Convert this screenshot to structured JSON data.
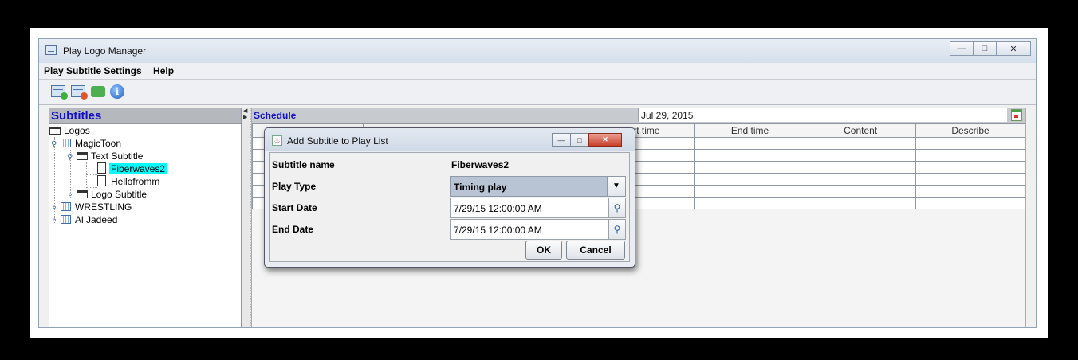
{
  "window": {
    "title": "Play Logo Manager",
    "buttons": [
      "minimize",
      "maximize",
      "close"
    ]
  },
  "menu": {
    "items": [
      "Play Subtitle Settings",
      "Help"
    ]
  },
  "toolbar": {
    "icons": [
      "add-subtitle-icon",
      "remove-subtitle-icon",
      "refresh-icon",
      "info-icon"
    ]
  },
  "left_panel": {
    "header": "Subtitles",
    "tree": [
      {
        "label": "Logos",
        "icon": "folder-icon"
      },
      {
        "label": "MagicToon",
        "icon": "grid-icon"
      },
      {
        "label": "Text Subtitle",
        "icon": "folder-icon"
      },
      {
        "label": "Fiberwaves2",
        "icon": "page-icon",
        "selected": true
      },
      {
        "label": "Hellofromm",
        "icon": "page-icon"
      },
      {
        "label": "Logo Subtitle",
        "icon": "folder-icon"
      },
      {
        "label": "WRESTLING",
        "icon": "grid-icon"
      },
      {
        "label": "Al Jadeed",
        "icon": "grid-icon"
      }
    ]
  },
  "schedule": {
    "header": "Schedule",
    "date": "Jul 29, 2015",
    "columns": [
      "Number",
      "Subtitle Name",
      "Play type",
      "Start time",
      "End time",
      "Content",
      "Describe"
    ]
  },
  "dialog": {
    "title": "Add Subtitle to Play List",
    "fields": {
      "subtitle_name_label": "Subtitle name",
      "subtitle_name_value": "Fiberwaves2",
      "play_type_label": "Play Type",
      "play_type_value": "Timing play",
      "start_date_label": "Start Date",
      "start_date_value": "7/29/15 12:00:00 AM",
      "end_date_label": "End Date",
      "end_date_value": "7/29/15 12:00:00 AM"
    },
    "ok_label": "OK",
    "cancel_label": "Cancel"
  }
}
